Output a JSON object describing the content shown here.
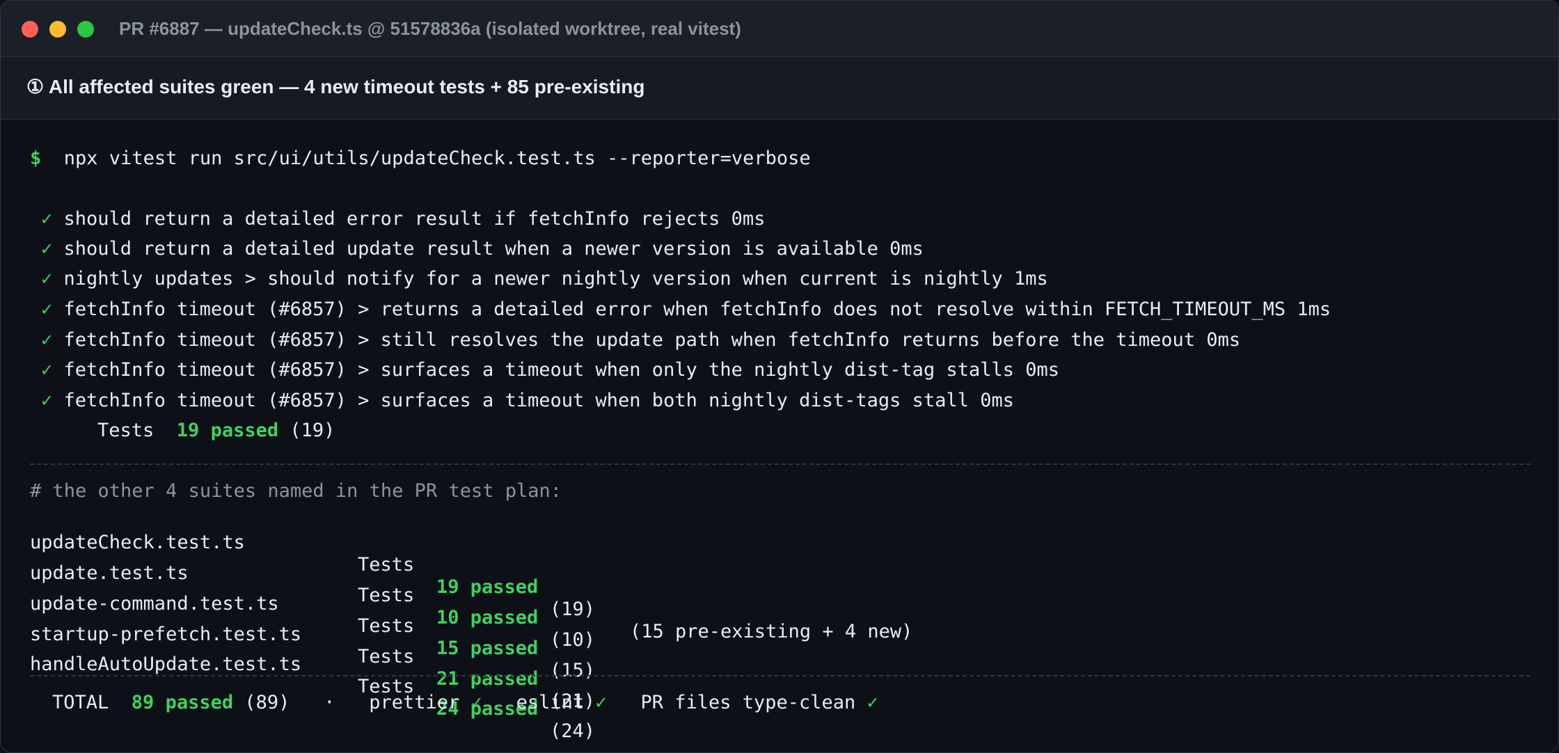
{
  "window": {
    "title": "PR #6887 — updateCheck.ts @ 51578836a (isolated worktree, real vitest)"
  },
  "banner": {
    "text": "① All affected suites green — 4 new timeout tests + 85 pre-existing"
  },
  "terminal": {
    "prompt": "$",
    "command": "npx vitest run src/ui/utils/updateCheck.test.ts --reporter=verbose",
    "check_glyph": "✓",
    "test_results": [
      "should return a detailed error result if fetchInfo rejects 0ms",
      "should return a detailed update result when a newer version is available 0ms",
      "nightly updates > should notify for a newer nightly version when current is nightly 1ms",
      "fetchInfo timeout (#6857) > returns a detailed error when fetchInfo does not resolve within FETCH_TIMEOUT_MS 1ms",
      "fetchInfo timeout (#6857) > still resolves the update path when fetchInfo returns before the timeout 0ms",
      "fetchInfo timeout (#6857) > surfaces a timeout when only the nightly dist-tag stalls 0ms",
      "fetchInfo timeout (#6857) > surfaces a timeout when both nightly dist-tags stall 0ms"
    ],
    "summary": {
      "label": "Tests",
      "passed": "19 passed",
      "total": "(19)"
    },
    "comment": "# the other 4 suites named in the PR test plan:",
    "suites": [
      {
        "name": "updateCheck.test.ts",
        "label": "Tests",
        "passed": "19 passed",
        "total": "(19)",
        "note": "(15 pre-existing + 4 new)"
      },
      {
        "name": "update.test.ts",
        "label": "Tests",
        "passed": "10 passed",
        "total": "(10)",
        "note": ""
      },
      {
        "name": "update-command.test.ts",
        "label": "Tests",
        "passed": "15 passed",
        "total": "(15)",
        "note": ""
      },
      {
        "name": "startup-prefetch.test.ts",
        "label": "Tests",
        "passed": "21 passed",
        "total": "(21)",
        "note": ""
      },
      {
        "name": "handleAutoUpdate.test.ts",
        "label": "Tests",
        "passed": "24 passed",
        "total": "(24)",
        "note": ""
      }
    ],
    "footer": {
      "total_label": "TOTAL",
      "total_passed": "89 passed",
      "total_count": "(89)",
      "dot": "·",
      "prettier": "prettier",
      "eslint": "eslint",
      "typecheck": "PR files type-clean",
      "check": "✓"
    }
  },
  "colors": {
    "background": "#0d1117",
    "titlebar": "#1b2027",
    "banner": "#161b22",
    "success": "#3fd15f",
    "text": "#e6edf3",
    "muted": "#8b949e",
    "close": "#ff5f57",
    "minimize": "#febc2e",
    "zoom": "#28c840"
  }
}
